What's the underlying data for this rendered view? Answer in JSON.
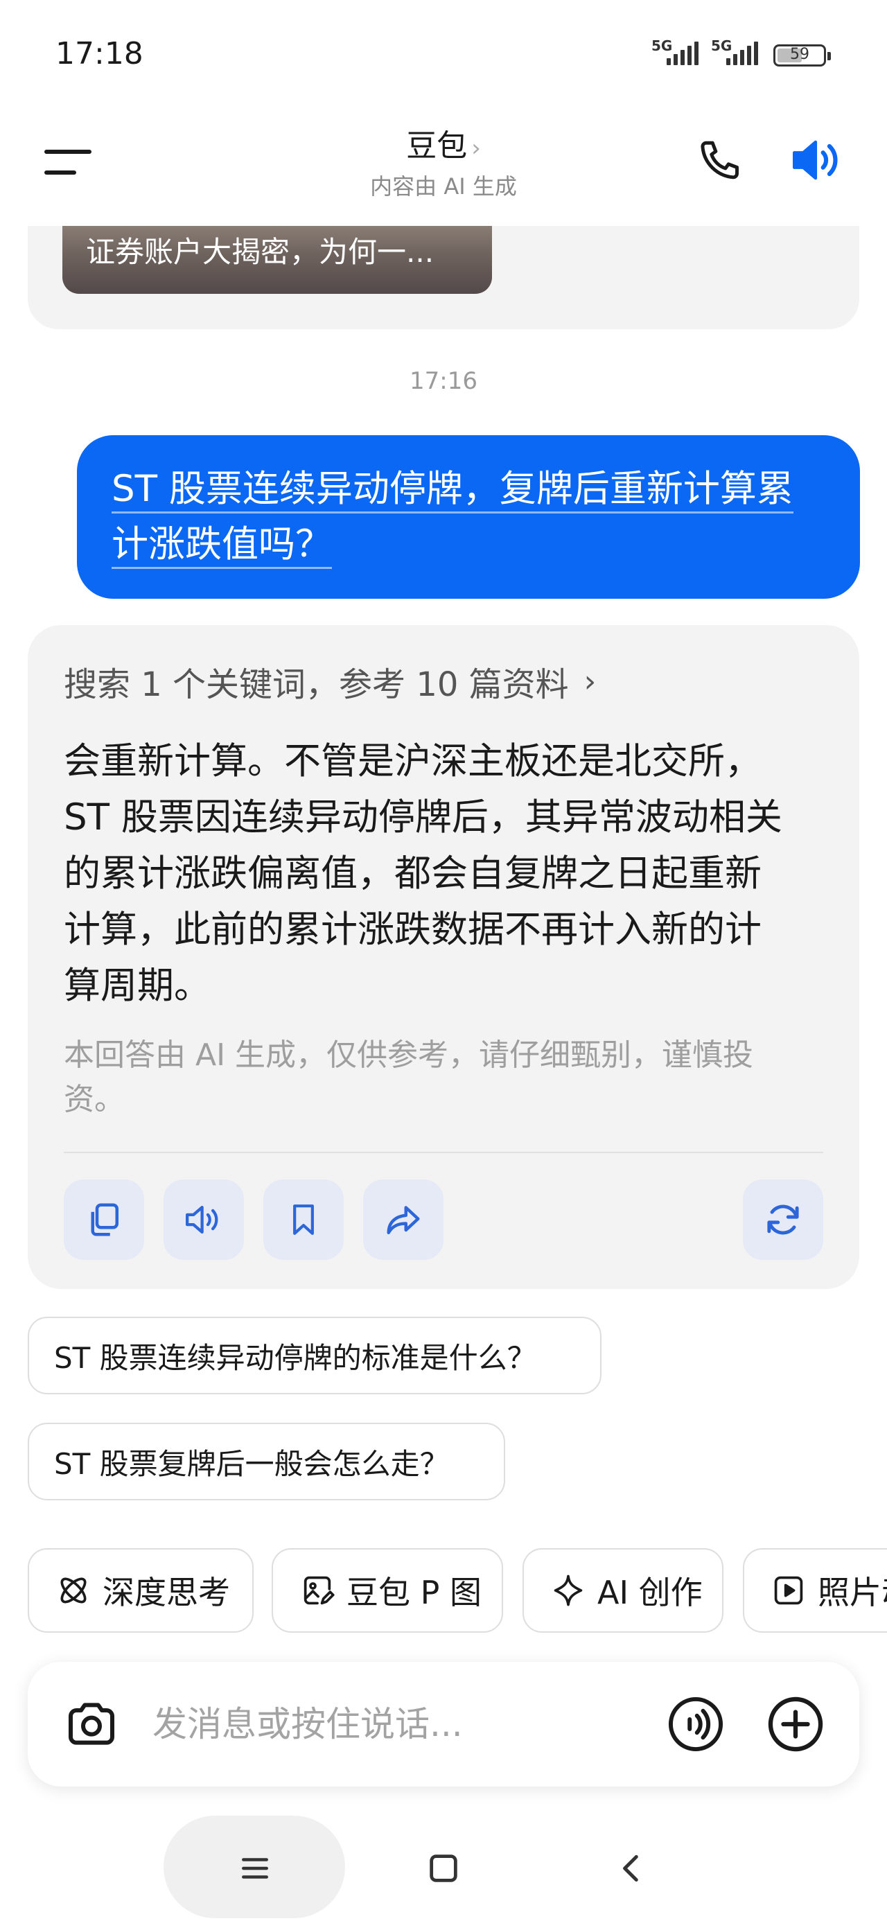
{
  "status_bar": {
    "time": "17:18",
    "signal_1": "5G",
    "signal_2": "5G",
    "battery": "59",
    "battery_level": 0.59
  },
  "header": {
    "title": "豆包",
    "title_chevron": "›",
    "subtitle": "内容由 AI 生成"
  },
  "previous_card": {
    "caption": "证券账户大揭密，为何一..."
  },
  "chat": {
    "timestamp": "17:16",
    "user_message": {
      "line1": "ST 股票连续异动停牌，复牌后重新计算累",
      "line2": "计涨跌值吗？"
    },
    "answer": {
      "search_summary": "搜索 1 个关键词，参考 10 篇资料",
      "search_chevron": "›",
      "lines": [
        "会重新计算。不管是沪深主板还是北交所，",
        "ST 股票因连续异动停牌后，其异常波动相关",
        "的累计涨跌偏离值，都会自复牌之日起重新",
        "计算，此前的累计涨跌数据不再计入新的计",
        "算周期。"
      ],
      "disclaimer_lines": [
        "本回答由 AI 生成，仅供参考，请仔细甄别，谨慎投",
        "资。"
      ]
    }
  },
  "suggestions": [
    "ST 股票连续异动停牌的标准是什么？",
    "ST 股票复牌后一般会怎么走？"
  ],
  "tools": [
    {
      "label": "深度思考",
      "icon": "atom-icon"
    },
    {
      "label": "豆包 P 图",
      "icon": "image-edit-icon"
    },
    {
      "label": "AI 创作",
      "icon": "sparkle-icon"
    },
    {
      "label": "照片动",
      "icon": "play-square-icon"
    }
  ],
  "input": {
    "placeholder": "发消息或按住说话..."
  },
  "colors": {
    "accent": "#0a68f5",
    "card_bg": "#f3f3f4",
    "action_bg": "#e6eaf6",
    "icon_blue": "#2d66d9"
  }
}
